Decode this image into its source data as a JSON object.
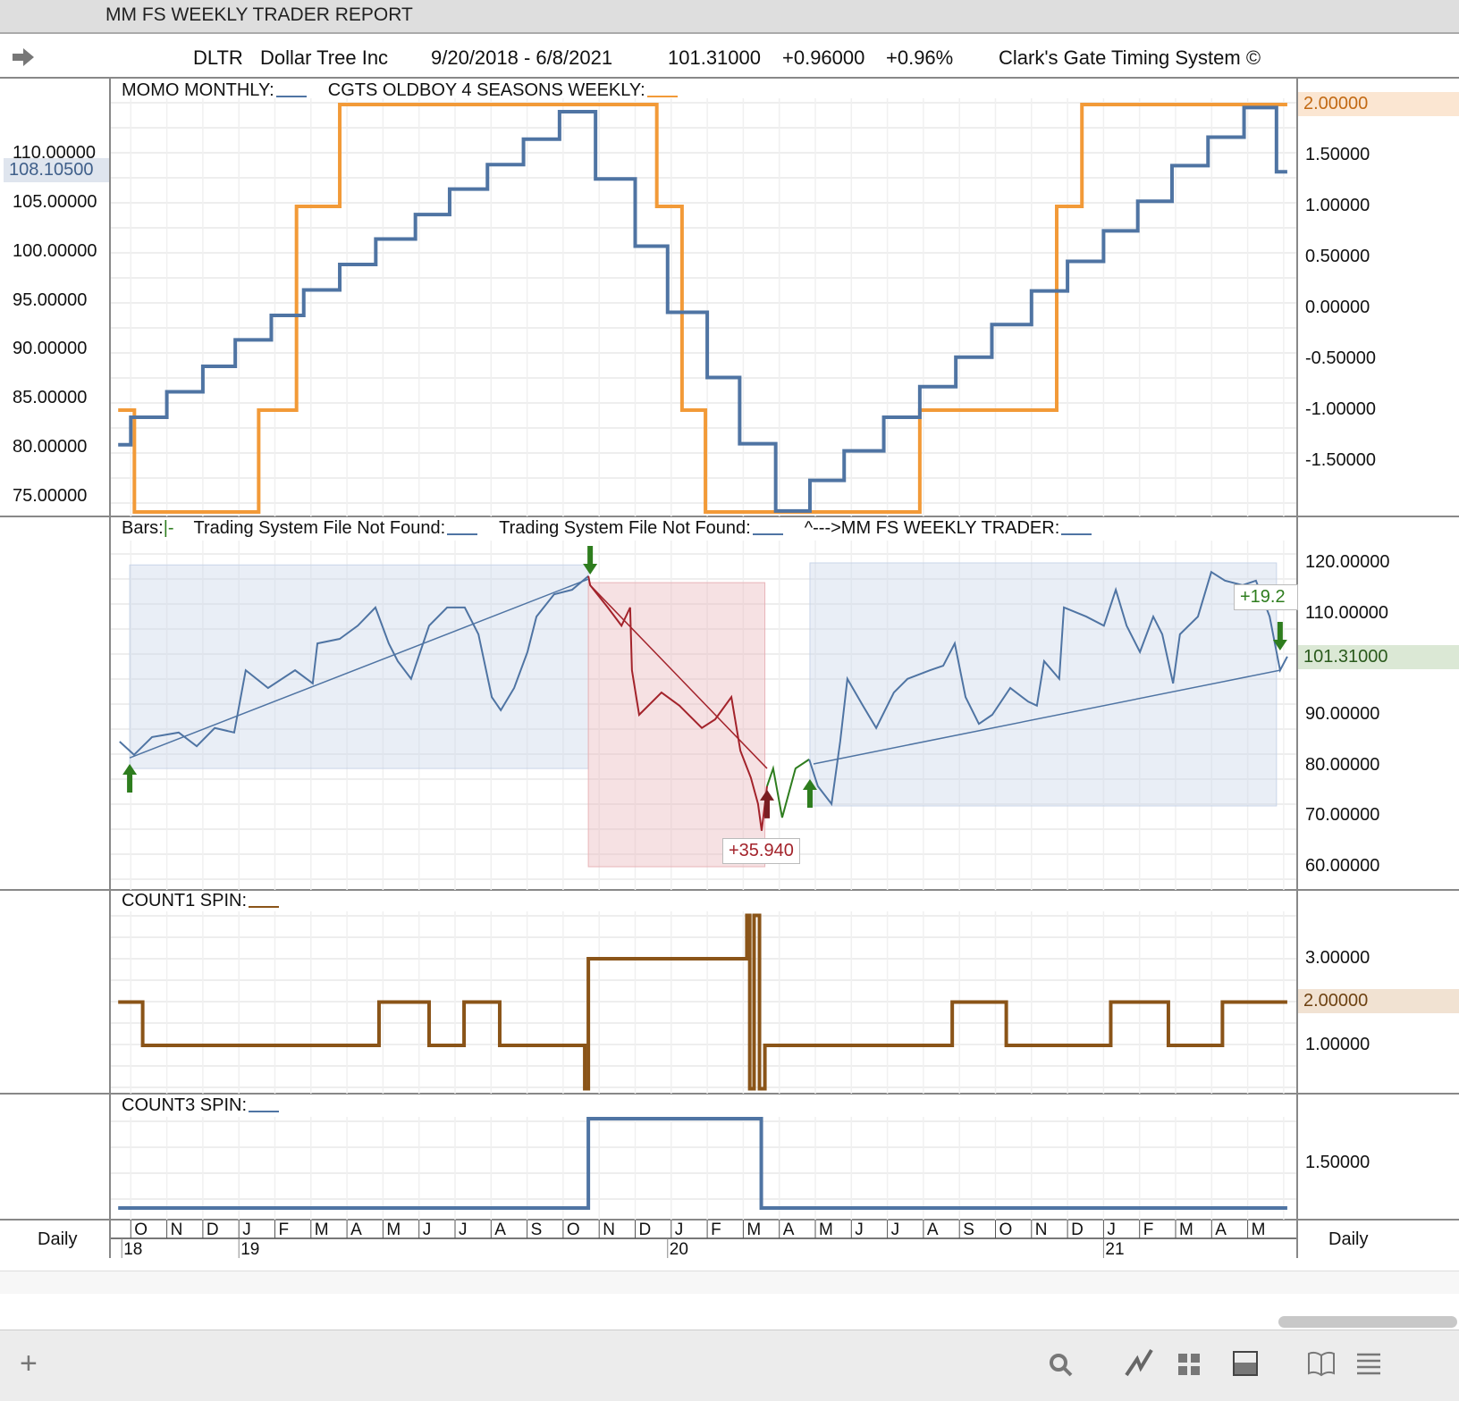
{
  "window": {
    "title": "MM FS WEEKLY TRADER REPORT"
  },
  "info": {
    "symbol": "DLTR",
    "name": "Dollar Tree Inc",
    "range": "9/20/2018 - 6/8/2021",
    "last": "101.31000",
    "change": "+0.96000",
    "pct": "+0.96%",
    "system": "Clark's Gate Timing System ©"
  },
  "panels": {
    "p1": {
      "label1": "MOMO MONTHLY:",
      "label2": "CGTS OLDBOY 4 SEASONS WEEKLY:",
      "left_ticks": [
        "110.00000",
        "105.00000",
        "100.00000",
        "95.00000",
        "90.00000",
        "85.00000",
        "80.00000",
        "75.00000"
      ],
      "left_highlight": "108.10500",
      "right_ticks": [
        "1.50000",
        "1.00000",
        "0.50000",
        "0.00000",
        "-0.50000",
        "-1.00000",
        "-1.50000"
      ],
      "right_highlight": "2.00000"
    },
    "p2": {
      "label0": "Bars:",
      "label0b": "|-",
      "label1": "Trading System File Not Found:",
      "label2": "Trading System File Not Found:",
      "label3": "^--->MM FS WEEKLY TRADER:",
      "right_ticks": [
        "120.00000",
        "110.00000",
        "90.00000",
        "80.00000",
        "70.00000",
        "60.00000"
      ],
      "right_highlight": "101.31000",
      "trade1": "+35.940",
      "trade2": "+19.2"
    },
    "p3": {
      "label": "COUNT1 SPIN:",
      "right_ticks": [
        "3.00000",
        "1.00000"
      ],
      "right_highlight": "2.00000"
    },
    "p4": {
      "label": "COUNT3 SPIN:",
      "right_ticks": [
        "1.50000"
      ]
    }
  },
  "axis": {
    "left_label": "Daily",
    "right_label": "Daily",
    "months": [
      "O",
      "N",
      "D",
      "J",
      "F",
      "M",
      "A",
      "M",
      "J",
      "J",
      "A",
      "S",
      "O",
      "N",
      "D",
      "J",
      "F",
      "M",
      "A",
      "M",
      "J",
      "J",
      "A",
      "S",
      "O",
      "N",
      "D",
      "J",
      "F",
      "M",
      "A",
      "M"
    ],
    "years": [
      "18",
      "19",
      "20",
      "21"
    ]
  },
  "colors": {
    "blue": "#4f74a3",
    "orange": "#f29a38",
    "red": "#a3232b",
    "green": "#2e7d1e",
    "brown": "#8a5418"
  },
  "chart_data": [
    {
      "type": "line",
      "title": "MOMO MONTHLY / CGTS OLDBOY 4 SEASONS WEEKLY",
      "x_unit": "months since Sep 2018",
      "ylim": [
        -2,
        2
      ],
      "series": [
        {
          "name": "MOMO MONTHLY",
          "step": true,
          "points": [
            [
              0.65,
              -1.34
            ],
            [
              1.0,
              -1.07
            ],
            [
              2.0,
              -0.82
            ],
            [
              3.0,
              -0.57
            ],
            [
              3.9,
              -0.31
            ],
            [
              4.9,
              -0.07
            ],
            [
              5.8,
              0.18
            ],
            [
              6.8,
              0.43
            ],
            [
              7.8,
              0.68
            ],
            [
              8.9,
              0.92
            ],
            [
              9.85,
              1.17
            ],
            [
              10.9,
              1.41
            ],
            [
              11.9,
              1.66
            ],
            [
              12.9,
              1.93
            ],
            [
              13.9,
              1.27
            ],
            [
              15.0,
              0.61
            ],
            [
              15.9,
              -0.04
            ],
            [
              17.0,
              -0.68
            ],
            [
              17.9,
              -1.33
            ],
            [
              18.9,
              -1.99
            ],
            [
              19.85,
              -1.69
            ],
            [
              20.8,
              -1.4
            ],
            [
              21.9,
              -1.07
            ],
            [
              22.9,
              -0.77
            ],
            [
              23.9,
              -0.48
            ],
            [
              24.9,
              -0.16
            ],
            [
              26.0,
              0.17
            ],
            [
              27.0,
              0.46
            ],
            [
              28.0,
              0.76
            ],
            [
              28.95,
              1.05
            ],
            [
              29.9,
              1.4
            ],
            [
              30.9,
              1.68
            ],
            [
              31.9,
              1.97
            ],
            [
              32.8,
              1.34
            ],
            [
              33.1,
              1.34
            ]
          ]
        },
        {
          "name": "CGTS OLDBOY 4 SEASONS WEEKLY",
          "step": true,
          "points": [
            [
              0.65,
              -1
            ],
            [
              1.1,
              -2
            ],
            [
              4.55,
              -1
            ],
            [
              5.6,
              1
            ],
            [
              6.8,
              2
            ],
            [
              15.6,
              1
            ],
            [
              16.3,
              -1
            ],
            [
              16.95,
              -2
            ],
            [
              22.9,
              -1
            ],
            [
              26.7,
              1
            ],
            [
              27.4,
              2
            ],
            [
              33.1,
              2
            ]
          ]
        }
      ]
    },
    {
      "type": "line",
      "title": "DLTR price",
      "ylim": [
        60,
        120
      ],
      "segments": [
        {
          "color": "blue",
          "points": [
            [
              0.69,
              84.7
            ],
            [
              1.09,
              82.1
            ],
            [
              1.59,
              85.6
            ],
            [
              2.33,
              86.5
            ],
            [
              2.83,
              83.8
            ],
            [
              3.33,
              87.4
            ],
            [
              3.87,
              86.5
            ],
            [
              4.19,
              98.8
            ],
            [
              4.81,
              95.3
            ],
            [
              5.56,
              98.8
            ],
            [
              6.05,
              96.2
            ],
            [
              6.18,
              104.1
            ],
            [
              6.8,
              105
            ],
            [
              7.3,
              107.6
            ],
            [
              7.79,
              111.2
            ],
            [
              8.16,
              104.1
            ],
            [
              8.41,
              100.6
            ],
            [
              8.78,
              97.1
            ],
            [
              9.28,
              107.6
            ],
            [
              9.78,
              111.2
            ],
            [
              10.27,
              111.2
            ],
            [
              10.65,
              105.9
            ],
            [
              11.02,
              93.5
            ],
            [
              11.27,
              90.9
            ],
            [
              11.64,
              95.3
            ],
            [
              12.01,
              102.4
            ],
            [
              12.26,
              109.4
            ],
            [
              12.75,
              113.8
            ],
            [
              13.25,
              114.7
            ],
            [
              13.7,
              117.4
            ]
          ]
        },
        {
          "color": "red",
          "points": [
            [
              13.7,
              117.4
            ],
            [
              13.75,
              115.6
            ],
            [
              14.24,
              111.2
            ],
            [
              14.62,
              107.6
            ],
            [
              14.86,
              111.2
            ],
            [
              14.91,
              98.8
            ],
            [
              15.11,
              90
            ],
            [
              15.73,
              94.4
            ],
            [
              16.23,
              91.8
            ],
            [
              16.85,
              87.4
            ],
            [
              17.22,
              89.1
            ],
            [
              17.67,
              93.5
            ],
            [
              17.92,
              82.9
            ],
            [
              18.21,
              77.6
            ],
            [
              18.41,
              72.4
            ],
            [
              18.51,
              67.1
            ],
            [
              18.66,
              75.9
            ]
          ]
        },
        {
          "color": "green",
          "points": [
            [
              18.66,
              75.9
            ],
            [
              18.83,
              79.4
            ],
            [
              19.08,
              69.7
            ],
            [
              19.45,
              79.4
            ],
            [
              19.83,
              81.2
            ]
          ]
        },
        {
          "color": "blue",
          "points": [
            [
              19.83,
              81.2
            ],
            [
              20.07,
              75.9
            ],
            [
              20.45,
              72.4
            ],
            [
              20.69,
              84.7
            ],
            [
              20.89,
              97.1
            ],
            [
              21.32,
              91.8
            ],
            [
              21.69,
              87.4
            ],
            [
              22.18,
              94.4
            ],
            [
              22.56,
              97.1
            ],
            [
              23.18,
              98.8
            ],
            [
              23.55,
              99.7
            ],
            [
              23.87,
              104.1
            ],
            [
              24.17,
              93.5
            ],
            [
              24.54,
              88.2
            ],
            [
              24.91,
              90
            ],
            [
              25.41,
              95.3
            ],
            [
              25.91,
              92.6
            ],
            [
              26.15,
              91.8
            ],
            [
              26.35,
              100.6
            ],
            [
              26.77,
              97.1
            ],
            [
              26.9,
              111.2
            ],
            [
              27.52,
              109.4
            ],
            [
              28.01,
              107.6
            ],
            [
              28.34,
              114.7
            ],
            [
              28.64,
              107.6
            ],
            [
              29.01,
              102.4
            ],
            [
              29.38,
              109.4
            ],
            [
              29.63,
              105.9
            ],
            [
              29.93,
              96.2
            ],
            [
              30.12,
              105.9
            ],
            [
              30.62,
              109.4
            ],
            [
              30.99,
              118.2
            ],
            [
              31.37,
              116.5
            ],
            [
              31.86,
              115.6
            ],
            [
              32.23,
              116.5
            ],
            [
              32.61,
              109.4
            ],
            [
              32.9,
              98.8
            ],
            [
              33.1,
              101.5
            ]
          ]
        }
      ],
      "trend_lines": [
        {
          "color": "blue",
          "from": [
            0.97,
            81.5
          ],
          "to": [
            13.7,
            116.8
          ]
        },
        {
          "color": "red",
          "from": [
            13.75,
            115.6
          ],
          "to": [
            18.66,
            79.4
          ]
        },
        {
          "color": "blue",
          "from": [
            19.95,
            80.3
          ],
          "to": [
            32.9,
            98.8
          ]
        }
      ],
      "trade_boxes": [
        {
          "color": "blue",
          "x": [
            0.97,
            13.7
          ],
          "y": [
            79.4,
            119.6
          ]
        },
        {
          "color": "red",
          "x": [
            13.7,
            18.6
          ],
          "y": [
            60,
            116.1
          ]
        },
        {
          "color": "blue",
          "x": [
            19.85,
            32.8
          ],
          "y": [
            72,
            120
          ]
        }
      ],
      "arrows": [
        {
          "dir": "up",
          "color": "green",
          "x": 0.97,
          "y": 81
        },
        {
          "dir": "down",
          "color": "green",
          "x": 13.75,
          "y": 117
        },
        {
          "dir": "up",
          "color": "red",
          "x": 18.66,
          "y": 75.9
        },
        {
          "dir": "up",
          "color": "green",
          "x": 19.85,
          "y": 78
        },
        {
          "dir": "down",
          "color": "green",
          "x": 32.9,
          "y": 102
        }
      ]
    },
    {
      "type": "line",
      "title": "COUNT1 SPIN",
      "ylim": [
        0,
        4
      ],
      "series": [
        {
          "name": "COUNT1 SPIN",
          "step": true,
          "points": [
            [
              0.65,
              2
            ],
            [
              1.33,
              1
            ],
            [
              7.89,
              2
            ],
            [
              9.28,
              1
            ],
            [
              10.25,
              2
            ],
            [
              11.24,
              1
            ],
            [
              13.6,
              0
            ],
            [
              13.7,
              3
            ],
            [
              18.1,
              4
            ],
            [
              18.18,
              0
            ],
            [
              18.3,
              4
            ],
            [
              18.45,
              0
            ],
            [
              18.6,
              1
            ],
            [
              23.8,
              2
            ],
            [
              25.3,
              1
            ],
            [
              28.2,
              2
            ],
            [
              29.8,
              1
            ],
            [
              31.3,
              2
            ],
            [
              33.1,
              2
            ]
          ]
        }
      ]
    },
    {
      "type": "line",
      "title": "COUNT3 SPIN",
      "ylim": [
        1,
        2
      ],
      "series": [
        {
          "name": "COUNT3 SPIN",
          "step": true,
          "points": [
            [
              0.65,
              1
            ],
            [
              13.7,
              2
            ],
            [
              18.5,
              1
            ],
            [
              33.1,
              1
            ]
          ]
        }
      ]
    }
  ]
}
